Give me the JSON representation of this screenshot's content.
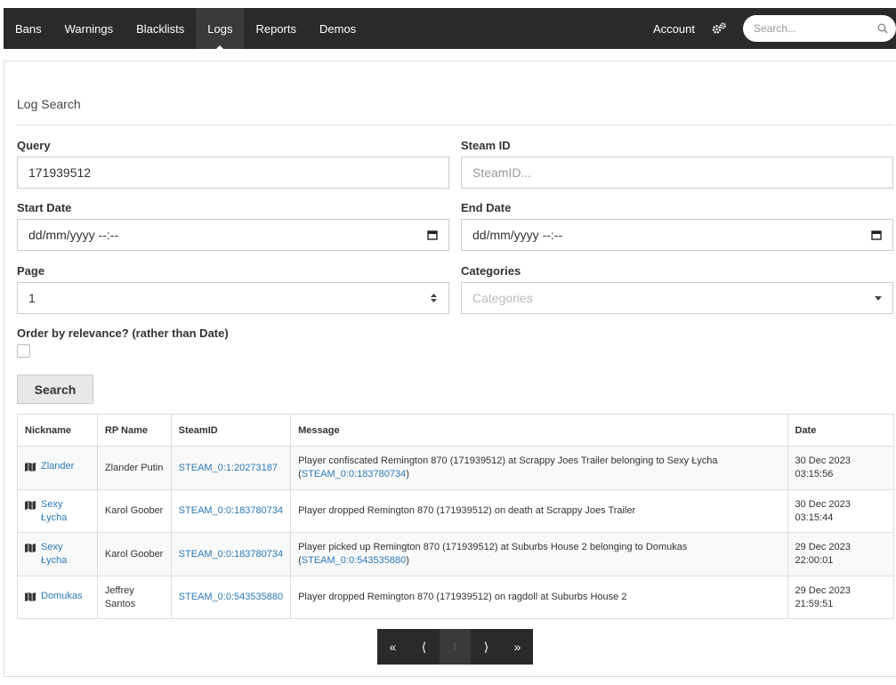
{
  "nav": {
    "items": [
      {
        "label": "Bans"
      },
      {
        "label": "Warnings"
      },
      {
        "label": "Blacklists"
      },
      {
        "label": "Logs"
      },
      {
        "label": "Reports"
      },
      {
        "label": "Demos"
      }
    ],
    "active_index": 3,
    "account_label": "Account",
    "search_placeholder": "Search..."
  },
  "page": {
    "title": "Log Search"
  },
  "form": {
    "query_label": "Query",
    "query_value": "171939512",
    "steamid_label": "Steam ID",
    "steamid_placeholder": "SteamID...",
    "start_date_label": "Start Date",
    "start_date_value": "dd/mm/yyyy --:--",
    "end_date_label": "End Date",
    "end_date_value": "dd/mm/yyyy --:--",
    "page_label": "Page",
    "page_value": "1",
    "categories_label": "Categories",
    "categories_placeholder": "Categories",
    "order_label": "Order by relevance? (rather than Date)",
    "order_checked": false,
    "search_button": "Search"
  },
  "table": {
    "headers": [
      "Nickname",
      "RP Name",
      "SteamID",
      "Message",
      "Date"
    ],
    "rows": [
      {
        "nickname": "Zlander",
        "rp_name": "Zlander Putin",
        "steamid": "STEAM_0:1:20273187",
        "message": "Player confiscated Remington 870 (171939512) at Scrappy Joes Trailer belonging to Sexy Łycha (",
        "message_link": "STEAM_0:0:183780734",
        "message_tail": ")",
        "date": "30 Dec 2023",
        "time": "03:15:56"
      },
      {
        "nickname": "Sexy Łycha",
        "rp_name": "Karol Goober",
        "steamid": "STEAM_0:0:183780734",
        "message": "Player dropped Remington 870 (171939512) on death at Scrappy Joes Trailer",
        "message_link": "",
        "message_tail": "",
        "date": "30 Dec 2023",
        "time": "03:15:44"
      },
      {
        "nickname": "Sexy Łycha",
        "rp_name": "Karol Goober",
        "steamid": "STEAM_0:0:183780734",
        "message": "Player picked up Remington 870 (171939512) at Suburbs House 2 belonging to Domukas (",
        "message_link": "STEAM_0:0:543535880",
        "message_tail": ")",
        "date": "29 Dec 2023",
        "time": "22:00:01"
      },
      {
        "nickname": "Domukas",
        "rp_name": "Jeffrey Santos",
        "steamid": "STEAM_0:0:543535880",
        "message": "Player dropped Remington 870 (171939512) on ragdoll at Suburbs House 2",
        "message_link": "",
        "message_tail": "",
        "date": "29 Dec 2023",
        "time": "21:59:51"
      }
    ]
  },
  "pagination": {
    "first": "«",
    "prev": "⟨",
    "current": "1",
    "next": "⟩",
    "last": "»"
  },
  "colors": {
    "navbar": "#2a2a2a",
    "link": "#2a7ab8"
  }
}
